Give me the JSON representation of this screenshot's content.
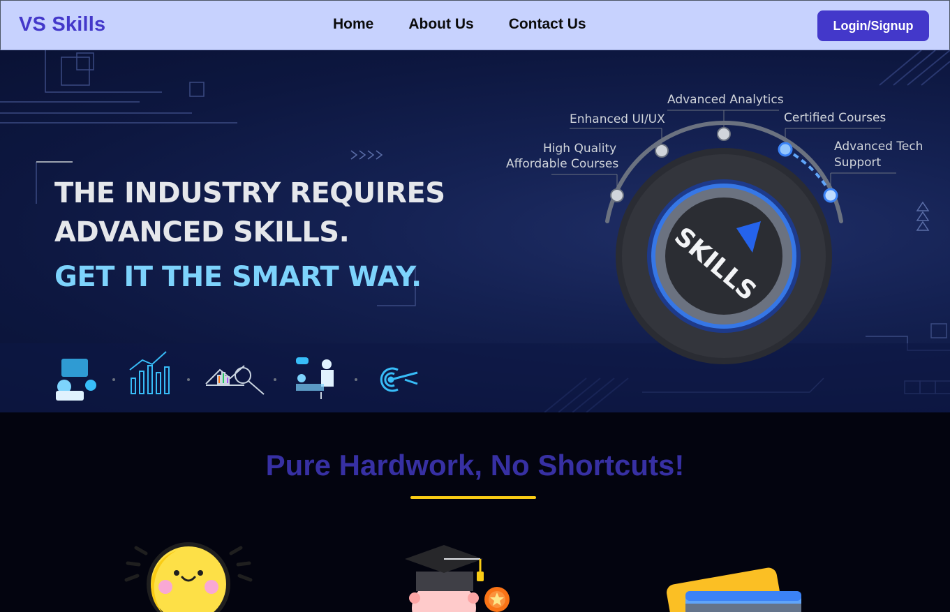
{
  "nav": {
    "brand": "VS Skills",
    "links": [
      "Home",
      "About Us",
      "Contact Us"
    ],
    "login_label": "Login/Signup"
  },
  "hero": {
    "line1": "THE INDUSTRY REQUIRES",
    "line2": "ADVANCED SKILLS.",
    "line3": "GET IT THE SMART WAY.",
    "dial_text": "SKILLS",
    "labels": {
      "high_quality": "High Quality",
      "affordable": "Affordable Courses",
      "enhanced_ui": "Enhanced UI/UX",
      "analytics": "Advanced Analytics",
      "certified": "Certified Courses",
      "tech": "Advanced Tech",
      "support": "Support"
    },
    "icons": [
      "team-icon",
      "growth-chart-icon",
      "analysis-icon",
      "presentation-icon",
      "target-icon"
    ]
  },
  "section": {
    "title": "Pure Hardwork, No Shortcuts!",
    "illustrations": [
      "smiling-sun-icon",
      "graduate-icon",
      "cards-icon"
    ]
  },
  "colors": {
    "brand": "#4338ca",
    "nav_bg": "#c7d2fe",
    "accent_yellow": "#facc15",
    "hero_bg": "#0d1740"
  }
}
